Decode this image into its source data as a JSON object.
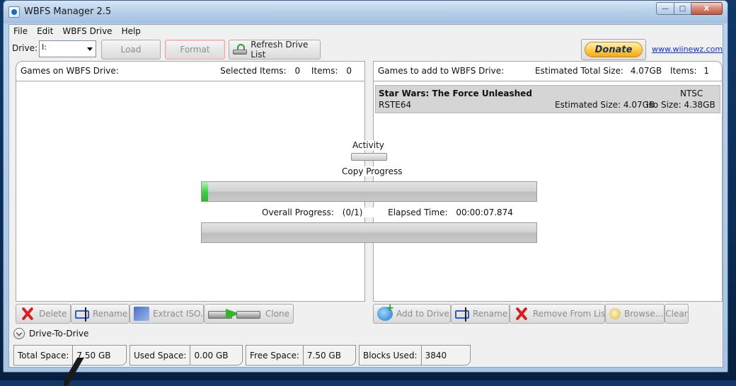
{
  "window": {
    "title": "WBFS Manager 2.5",
    "controls": {
      "minimize": "—",
      "maximize": "□",
      "close": "X"
    }
  },
  "menu": [
    "File",
    "Edit",
    "WBFS Drive",
    "Help"
  ],
  "toolbar": {
    "drive_label": "Drive:",
    "drive_value": "I:",
    "load_label": "Load",
    "format_label": "Format",
    "refresh_label": "Refresh Drive List",
    "donate_label": "Donate",
    "site_link": "www.wiinewz.com"
  },
  "left_panel": {
    "title": "Games on WBFS Drive:",
    "selected_label": "Selected Items:",
    "selected_value": "0",
    "items_label": "Items:",
    "items_value": "0"
  },
  "right_panel": {
    "title": "Games to add to WBFS Drive:",
    "est_total_label": "Estimated Total Size:",
    "est_total_value": "4.07GB",
    "items_label": "Items:",
    "items_value": "1",
    "games": [
      {
        "title": "Star Wars:  The Force Unleashed",
        "region": "NTSC",
        "id": "RSTE64",
        "est_size": "Estimated Size: 4.07GB",
        "iso_size": "Iso Size: 4.38GB"
      }
    ]
  },
  "activity": {
    "activity_label": "Activity",
    "copy_label": "Copy Progress",
    "copy_progress": 0.018,
    "overall_label": "Overall Progress:",
    "overall_value": "(0/1)",
    "elapsed_label": "Elapsed Time:",
    "elapsed_value": "00:00:07.874",
    "overall_progress": 0
  },
  "left_buttons": {
    "delete": "Delete",
    "rename": "Rename",
    "extract": "Extract ISO...",
    "clone": "Clone"
  },
  "right_buttons": {
    "add": "Add to Drive",
    "rename": "Rename",
    "remove": "Remove From List",
    "browse": "Browse...",
    "clear": "Clear"
  },
  "drive_to_drive": "Drive-To-Drive",
  "status": {
    "total_label": "Total Space:",
    "total_value": "7.50 GB",
    "used_label": "Used Space:",
    "used_value": "0.00 GB",
    "free_label": "Free Space:",
    "free_value": "7.50 GB",
    "blocks_label": "Blocks Used:",
    "blocks_value": "3840"
  }
}
